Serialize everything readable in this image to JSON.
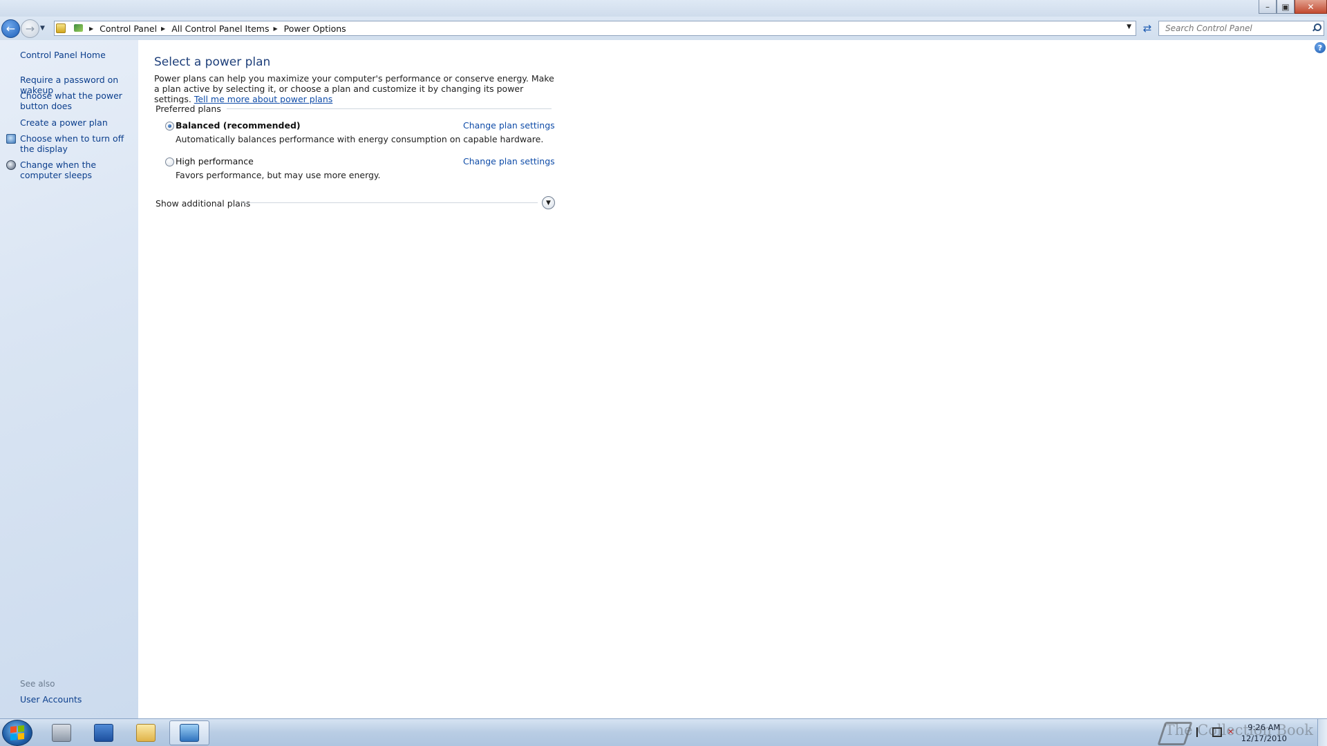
{
  "window": {
    "minimize_label": "–",
    "maximize_label": "▣",
    "close_label": "✕"
  },
  "nav": {
    "breadcrumbs": [
      "Control Panel",
      "All Control Panel Items",
      "Power Options"
    ],
    "search_placeholder": "Search Control Panel"
  },
  "sidebar": {
    "home": "Control Panel Home",
    "links": [
      "Require a password on wakeup",
      "Choose what the power button does",
      "Create a power plan",
      "Choose when to turn off the display",
      "Change when the computer sleeps"
    ],
    "see_also_heading": "See also",
    "see_also_links": [
      "User Accounts"
    ]
  },
  "main": {
    "title": "Select a power plan",
    "description": "Power plans can help you maximize your computer's performance or conserve energy. Make a plan active by selecting it, or choose a plan and customize it by changing its power settings.",
    "learn_more_link": "Tell me more about power plans",
    "preferred_plans_label": "Preferred plans",
    "plans": [
      {
        "name": "Balanced (recommended)",
        "description": "Automatically balances performance with energy consumption on capable hardware.",
        "selected": true,
        "link": "Change plan settings"
      },
      {
        "name": "High performance",
        "description": "Favors performance, but may use more energy.",
        "selected": false,
        "link": "Change plan settings"
      }
    ],
    "show_additional_plans": "Show additional plans",
    "help_glyph": "?"
  },
  "taskbar": {
    "time": "9:26 AM",
    "date": "12/17/2010",
    "watermark": "The Collection Book"
  },
  "colors": {
    "link": "#0f4ca8",
    "title": "#1e3f7a",
    "sidebar_bg": "#dae5f3"
  },
  "icons": {
    "back": "back-arrow-icon",
    "forward": "forward-arrow-icon",
    "refresh": "refresh-icon",
    "search": "search-icon",
    "help": "help-icon",
    "expand": "chevron-down-icon"
  }
}
